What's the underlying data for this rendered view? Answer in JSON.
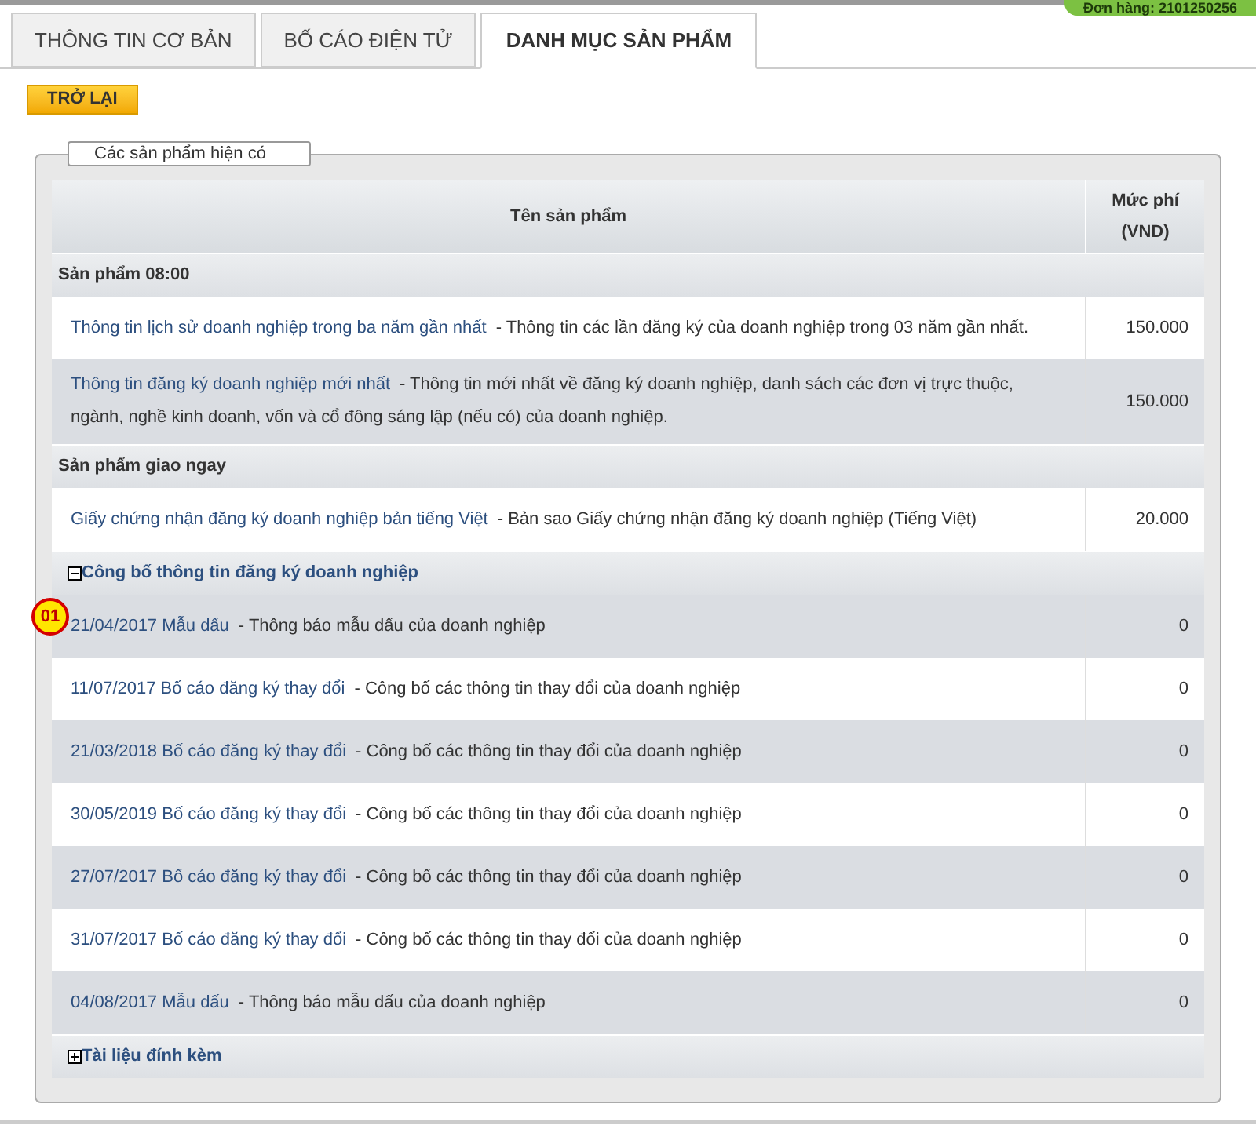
{
  "order_badge": "Đơn hàng: 2101250256",
  "tabs": [
    {
      "label": "THÔNG TIN CƠ BẢN",
      "selected": false
    },
    {
      "label": "BỐ CÁO ĐIỆN TỬ",
      "selected": false
    },
    {
      "label": "DANH MỤC SẢN PHẨM",
      "selected": true
    }
  ],
  "back_button": "TRỞ LẠI",
  "panel": {
    "legend": "Các sản phẩm hiện có",
    "table": {
      "columns": [
        "Tên sản phẩm",
        "Mức phí (VND)"
      ],
      "sections": [
        {
          "kind": "group",
          "title": "Sản phẩm 08:00",
          "rows": [
            {
              "link": "Thông tin lịch sử doanh nghiệp trong ba năm gần nhất",
              "description": "- Thông tin các lần đăng ký của doanh nghiệp trong 03 năm gần nhất.",
              "price": "150.000"
            },
            {
              "link": "Thông tin đăng ký doanh nghiệp mới nhất",
              "description": "- Thông tin mới nhất về đăng ký doanh nghiệp, danh sách các đơn vị trực thuộc, ngành, nghề kinh doanh, vốn và cổ đông sáng lập (nếu có) của doanh nghiệp.",
              "price": "150.000"
            }
          ]
        },
        {
          "kind": "group",
          "title": "Sản phẩm giao ngay",
          "rows": [
            {
              "link": "Giấy chứng nhận đăng ký doanh nghiệp bản tiếng Việt",
              "description": "- Bản sao Giấy chứng nhận đăng ký doanh nghiệp (Tiếng Việt)",
              "price": "20.000"
            }
          ]
        },
        {
          "kind": "collapsible",
          "title": "Công bố thông tin đăng ký doanh nghiệp",
          "expanded": true,
          "rows": [
            {
              "link": "21/04/2017 Mẫu dấu",
              "description": "- Thông báo mẫu dấu của doanh nghiệp",
              "price": "0",
              "marker": "01"
            },
            {
              "link": "11/07/2017 Bố cáo đăng ký thay đổi",
              "description": "- Công bố các thông tin thay đổi của doanh nghiệp",
              "price": "0"
            },
            {
              "link": "21/03/2018 Bố cáo đăng ký thay đổi",
              "description": "- Công bố các thông tin thay đổi của doanh nghiệp",
              "price": "0"
            },
            {
              "link": "30/05/2019 Bố cáo đăng ký thay đổi",
              "description": "- Công bố các thông tin thay đổi của doanh nghiệp",
              "price": "0"
            },
            {
              "link": "27/07/2017 Bố cáo đăng ký thay đổi",
              "description": "- Công bố các thông tin thay đổi của doanh nghiệp",
              "price": "0"
            },
            {
              "link": "31/07/2017 Bố cáo đăng ký thay đổi",
              "description": "- Công bố các thông tin thay đổi của doanh nghiệp",
              "price": "0"
            },
            {
              "link": "04/08/2017 Mẫu dấu",
              "description": "- Thông báo mẫu dấu của doanh nghiệp",
              "price": "0"
            }
          ]
        },
        {
          "kind": "collapsible",
          "title": "Tài liệu đính kèm",
          "expanded": false
        }
      ]
    }
  }
}
